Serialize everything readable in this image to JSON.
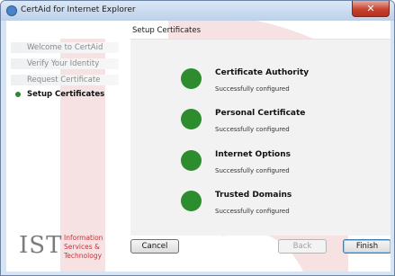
{
  "window": {
    "title": "CertAid for Internet Explorer",
    "close_symbol": "✕"
  },
  "header": {
    "title": "Setup Certificates"
  },
  "steps": [
    {
      "label": "Welcome to CertAid",
      "state": "done"
    },
    {
      "label": "Verify Your Identity",
      "state": "done"
    },
    {
      "label": "Request Certificate",
      "state": "done"
    },
    {
      "label": "Setup Certificates",
      "state": "current"
    }
  ],
  "status_items": [
    {
      "title": "Certificate Authority",
      "status": "Successfully configured"
    },
    {
      "title": "Personal Certificate",
      "status": "Successfully configured"
    },
    {
      "title": "Internet Options",
      "status": "Successfully configured"
    },
    {
      "title": "Trusted Domains",
      "status": "Successfully configured"
    }
  ],
  "logo": {
    "mark": "IST",
    "lines": [
      "Information",
      "Services &",
      "Technology"
    ]
  },
  "buttons": {
    "cancel": "Cancel",
    "back": "Back",
    "finish": "Finish"
  },
  "colors": {
    "success": "#2d8c2d",
    "logo_accent": "#c0353f",
    "watermark": "#f3dada"
  }
}
